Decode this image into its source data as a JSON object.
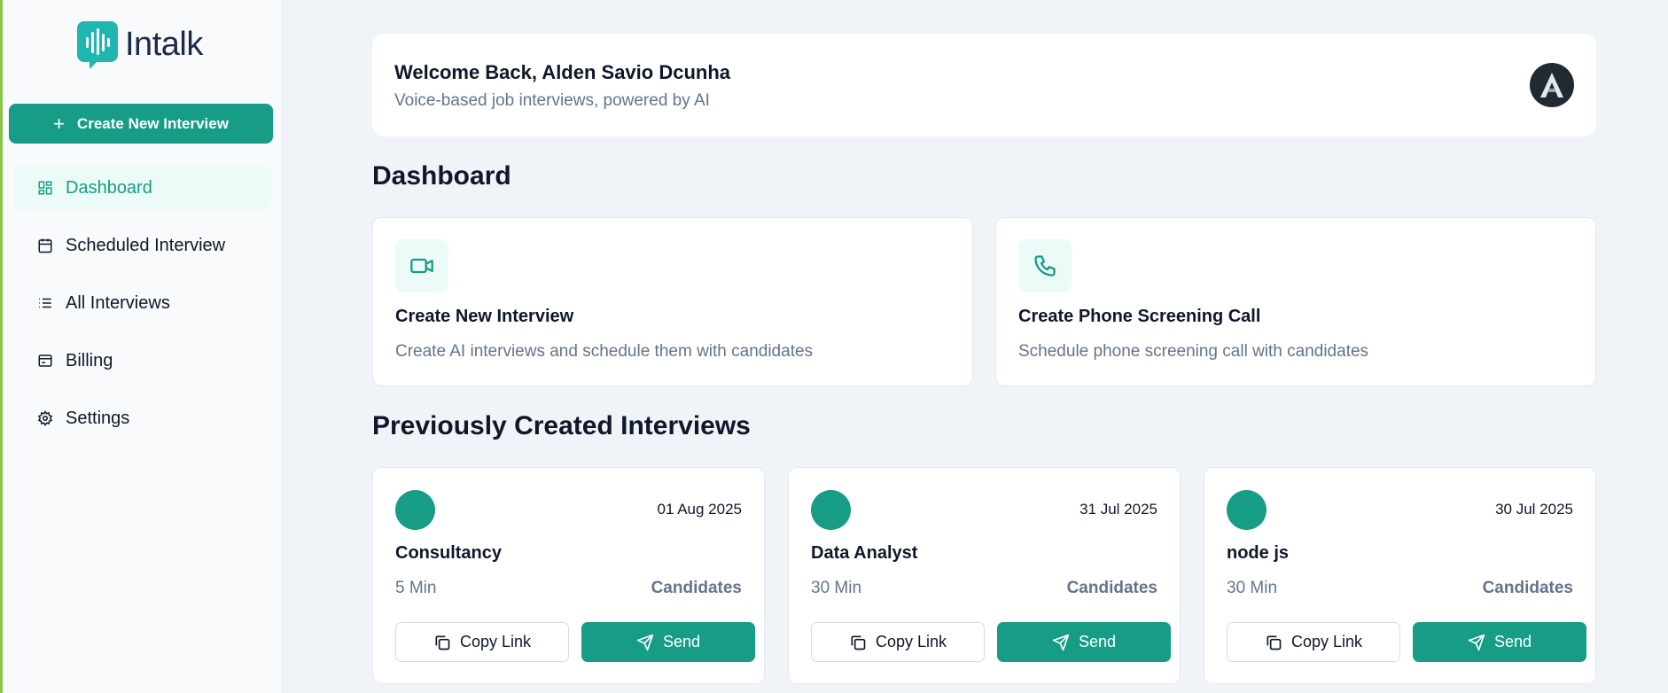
{
  "brand": {
    "name": "Intalk",
    "accent": "#179c86"
  },
  "sidebar": {
    "create_button": "Create New Interview",
    "items": [
      {
        "label": "Dashboard",
        "icon": "dashboard-grid-icon",
        "active": true
      },
      {
        "label": "Scheduled Interview",
        "icon": "calendar-icon",
        "active": false
      },
      {
        "label": "All Interviews",
        "icon": "list-icon",
        "active": false
      },
      {
        "label": "Billing",
        "icon": "wallet-icon",
        "active": false
      },
      {
        "label": "Settings",
        "icon": "gear-icon",
        "active": false
      }
    ]
  },
  "header": {
    "title": "Welcome Back, Alden Savio Dcunha",
    "subtitle": "Voice-based job interviews, powered by AI",
    "avatar_letter": "A"
  },
  "dashboard": {
    "title": "Dashboard",
    "actions": [
      {
        "title": "Create New Interview",
        "description": "Create AI interviews and schedule them with candidates",
        "icon": "video-camera-icon"
      },
      {
        "title": "Create Phone Screening Call",
        "description": "Schedule phone screening call with candidates",
        "icon": "phone-icon"
      }
    ]
  },
  "previous": {
    "title": "Previously Created Interviews",
    "copy_label": "Copy Link",
    "send_label": "Send",
    "candidates_label": "Candidates",
    "interviews": [
      {
        "date": "01 Aug 2025",
        "name": "Consultancy",
        "duration": "5 Min"
      },
      {
        "date": "31 Jul 2025",
        "name": "Data Analyst",
        "duration": "30 Min"
      },
      {
        "date": "30 Jul 2025",
        "name": "node js",
        "duration": "30 Min"
      }
    ]
  }
}
